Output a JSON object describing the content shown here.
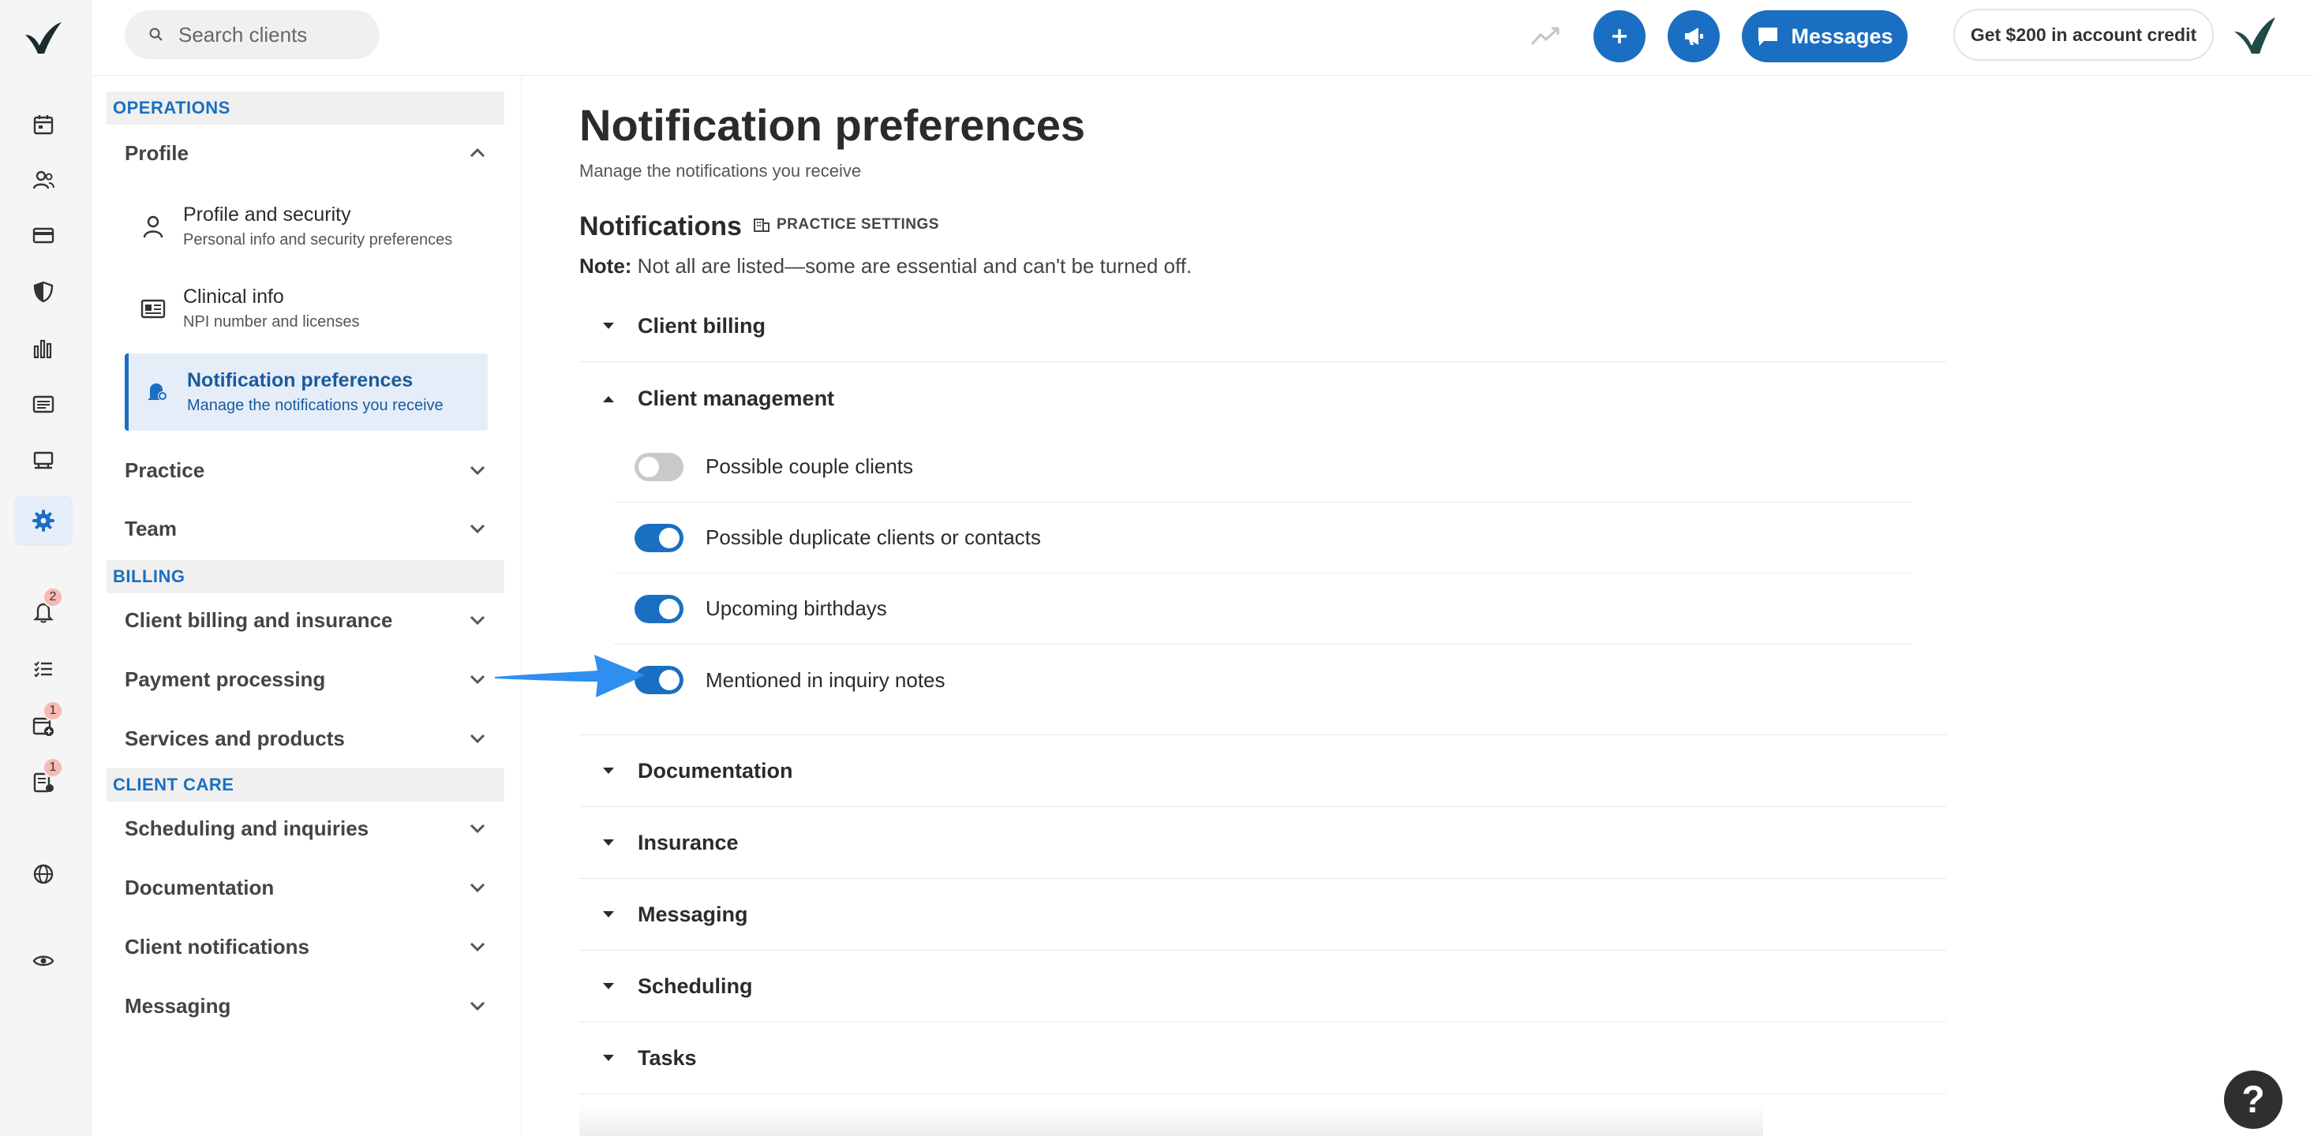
{
  "topbar": {
    "search_placeholder": "Search clients",
    "messages_label": "Messages",
    "credit_label": "Get $200 in account credit",
    "accent": "#1a6fc2"
  },
  "rail": {
    "items": [
      "calendar-icon",
      "clients-icon",
      "billing-card-icon",
      "shield-icon",
      "reports-icon",
      "list-icon",
      "marketplace-icon",
      "settings-gear-icon",
      "bell-icon",
      "tasks-icon",
      "calendar-add-icon",
      "requests-icon",
      "globe-icon",
      "eye-icon"
    ],
    "badges": {
      "bell": "2",
      "calendar_add": "1",
      "requests": "1"
    }
  },
  "sidebar": {
    "operations_heading": "OPERATIONS",
    "profile_label": "Profile",
    "sub_items": [
      {
        "title": "Profile and security",
        "desc": "Personal info and security preferences"
      },
      {
        "title": "Clinical info",
        "desc": "NPI number and licenses"
      },
      {
        "title": "Notification preferences",
        "desc": "Manage the notifications you receive"
      }
    ],
    "practice_label": "Practice",
    "team_label": "Team",
    "billing_heading": "BILLING",
    "billing_items": [
      "Client billing and insurance",
      "Payment processing",
      "Services and products"
    ],
    "client_care_heading": "CLIENT CARE",
    "client_care_items": [
      "Scheduling and inquiries",
      "Documentation",
      "Client notifications",
      "Messaging"
    ]
  },
  "main": {
    "title": "Notification preferences",
    "subtitle": "Manage the notifications you receive",
    "notifications_heading": "Notifications",
    "practice_settings_link": "PRACTICE SETTINGS",
    "note_label": "Note:",
    "note_text": " Not all are listed—some are essential and can't be turned off.",
    "categories": [
      {
        "label": "Client billing",
        "expanded": false
      },
      {
        "label": "Client management",
        "expanded": true
      },
      {
        "label": "Documentation",
        "expanded": false
      },
      {
        "label": "Insurance",
        "expanded": false
      },
      {
        "label": "Messaging",
        "expanded": false
      },
      {
        "label": "Scheduling",
        "expanded": false
      },
      {
        "label": "Tasks",
        "expanded": false
      }
    ],
    "client_management_toggles": [
      {
        "label": "Possible couple clients",
        "on": false
      },
      {
        "label": "Possible duplicate clients or contacts",
        "on": true
      },
      {
        "label": "Upcoming birthdays",
        "on": true
      },
      {
        "label": "Mentioned in inquiry notes",
        "on": true
      }
    ]
  },
  "help_label": "?"
}
